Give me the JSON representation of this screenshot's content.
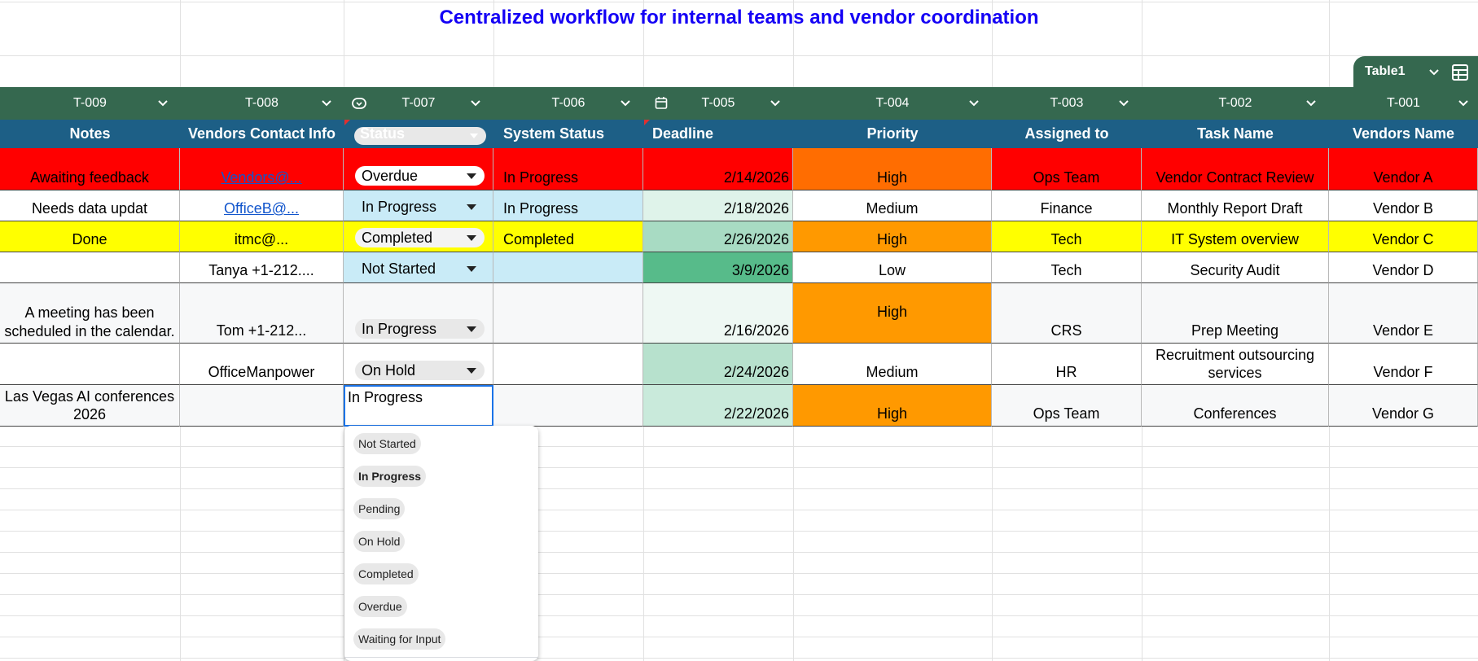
{
  "title": "Centralized workflow for internal teams and vendor coordination",
  "table_tab": {
    "name": "Table1"
  },
  "header_ids": [
    "T-009",
    "T-008",
    "T-007",
    "T-006",
    "T-005",
    "T-004",
    "T-003",
    "T-002",
    "T-001"
  ],
  "columns": [
    "Notes",
    "Vendors Contact Info",
    "Status",
    "System Status",
    "Deadline",
    "Priority",
    "Assigned to",
    "Task Name",
    "Vendors Name"
  ],
  "rows": [
    {
      "notes": "Awaiting feedback",
      "contact": "Vendors@...",
      "status": "Overdue",
      "system_status": "In Progress",
      "deadline": "2/14/2026",
      "priority": "High",
      "assigned": "Ops Team",
      "task": "Vendor Contract Review",
      "vendor": "Vendor A"
    },
    {
      "notes": "Needs data updat",
      "contact": "OfficeB@...",
      "status": "In Progress",
      "system_status": "In Progress",
      "deadline": "2/18/2026",
      "priority": "Medium",
      "assigned": "Finance",
      "task": "Monthly Report Draft",
      "vendor": "Vendor B"
    },
    {
      "notes": "Done",
      "contact": "itmc@...",
      "status": "Completed",
      "system_status": "Completed",
      "deadline": "2/26/2026",
      "priority": "High",
      "assigned": "Tech",
      "task": "IT System overview",
      "vendor": "Vendor C"
    },
    {
      "notes": "",
      "contact": "Tanya +1-212....",
      "status": "Not Started",
      "system_status": "",
      "deadline": "3/9/2026",
      "priority": "Low",
      "assigned": "Tech",
      "task": "Security Audit",
      "vendor": "Vendor D"
    },
    {
      "notes": "A meeting has been scheduled in the calendar.",
      "contact": "Tom +1-212...",
      "status": "In Progress",
      "system_status": "",
      "deadline": "2/16/2026",
      "priority": "High",
      "assigned": "CRS",
      "task": "Prep Meeting",
      "vendor": "Vendor E"
    },
    {
      "notes": "",
      "contact": "OfficeManpower",
      "status": "On Hold",
      "system_status": "",
      "deadline": "2/24/2026",
      "priority": "Medium",
      "assigned": "HR",
      "task": "Recruitment outsourcing services",
      "vendor": "Vendor  F"
    },
    {
      "notes": "Las Vegas AI conferences 2026",
      "contact": "",
      "status": "In Progress",
      "system_status": "",
      "deadline": "2/22/2026",
      "priority": "High",
      "assigned": "Ops Team",
      "task": "Conferences",
      "vendor": "Vendor G"
    }
  ],
  "dropdown_options": [
    "Not Started",
    "In Progress",
    "Pending",
    "On Hold",
    "Completed",
    "Overdue",
    "Waiting for Input"
  ],
  "colors": {
    "header_green": "#35684f",
    "column_blue": "#1d5f86",
    "red": "#ff0000",
    "yellow": "#ffff00",
    "orange_high": "#ff9900",
    "orange_dark": "#ff6d01",
    "light_blue": "#c9ebf7",
    "deadline_light": "#dff3ea",
    "deadline_mid": "#a8dbc3",
    "deadline_strong": "#57bb8a",
    "title_blue": "#1400f5"
  }
}
